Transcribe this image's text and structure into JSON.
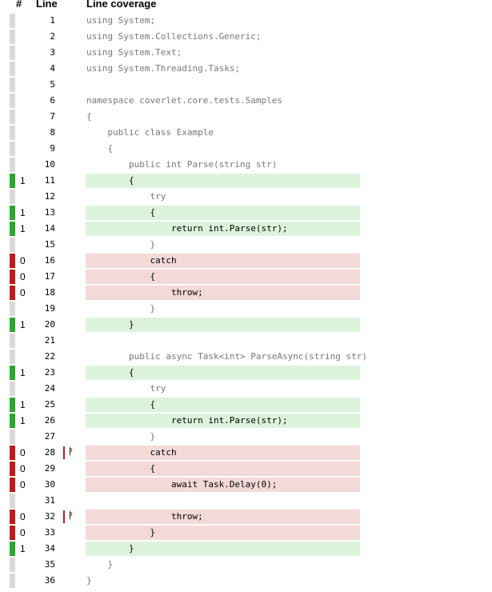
{
  "header": {
    "hash": "#",
    "line": "Line",
    "coverage": "Line coverage"
  },
  "colors": {
    "covered": "#2aa82a",
    "uncovered": "#c21a1a",
    "covered_bg": "#dcf4dc",
    "uncovered_bg": "#f4d9d9",
    "neutral": "#d9d9d9"
  },
  "lines": [
    {
      "n": "1",
      "hits": "",
      "status": "none",
      "branch": false,
      "code": "using System;"
    },
    {
      "n": "2",
      "hits": "",
      "status": "none",
      "branch": false,
      "code": "using System.Collections.Generic;"
    },
    {
      "n": "3",
      "hits": "",
      "status": "none",
      "branch": false,
      "code": "using System.Text;"
    },
    {
      "n": "4",
      "hits": "",
      "status": "none",
      "branch": false,
      "code": "using System.Threading.Tasks;"
    },
    {
      "n": "5",
      "hits": "",
      "status": "none",
      "branch": false,
      "code": ""
    },
    {
      "n": "6",
      "hits": "",
      "status": "none",
      "branch": false,
      "code": "namespace coverlet.core.tests.Samples"
    },
    {
      "n": "7",
      "hits": "",
      "status": "none",
      "branch": false,
      "code": "{"
    },
    {
      "n": "8",
      "hits": "",
      "status": "none",
      "branch": false,
      "code": "    public class Example"
    },
    {
      "n": "9",
      "hits": "",
      "status": "none",
      "branch": false,
      "code": "    {"
    },
    {
      "n": "10",
      "hits": "",
      "status": "none",
      "branch": false,
      "code": "        public int Parse(string str)"
    },
    {
      "n": "11",
      "hits": "1",
      "status": "covered",
      "branch": false,
      "code": "        {"
    },
    {
      "n": "12",
      "hits": "",
      "status": "none",
      "branch": false,
      "code": "            try"
    },
    {
      "n": "13",
      "hits": "1",
      "status": "covered",
      "branch": false,
      "code": "            {"
    },
    {
      "n": "14",
      "hits": "1",
      "status": "covered",
      "branch": false,
      "code": "                return int.Parse(str);"
    },
    {
      "n": "15",
      "hits": "",
      "status": "none",
      "branch": false,
      "code": "            }"
    },
    {
      "n": "16",
      "hits": "0",
      "status": "uncovered",
      "branch": false,
      "code": "            catch"
    },
    {
      "n": "17",
      "hits": "0",
      "status": "uncovered",
      "branch": false,
      "code": "            {"
    },
    {
      "n": "18",
      "hits": "0",
      "status": "uncovered",
      "branch": false,
      "code": "                throw;"
    },
    {
      "n": "19",
      "hits": "",
      "status": "none",
      "branch": false,
      "code": "            }"
    },
    {
      "n": "20",
      "hits": "1",
      "status": "covered",
      "branch": false,
      "code": "        }"
    },
    {
      "n": "21",
      "hits": "",
      "status": "none",
      "branch": false,
      "code": ""
    },
    {
      "n": "22",
      "hits": "",
      "status": "none",
      "branch": false,
      "code": "        public async Task<int> ParseAsync(string str)"
    },
    {
      "n": "23",
      "hits": "1",
      "status": "covered",
      "branch": false,
      "code": "        {"
    },
    {
      "n": "24",
      "hits": "",
      "status": "none",
      "branch": false,
      "code": "            try"
    },
    {
      "n": "25",
      "hits": "1",
      "status": "covered",
      "branch": false,
      "code": "            {"
    },
    {
      "n": "26",
      "hits": "1",
      "status": "covered",
      "branch": false,
      "code": "                return int.Parse(str);"
    },
    {
      "n": "27",
      "hits": "",
      "status": "none",
      "branch": false,
      "code": "            }"
    },
    {
      "n": "28",
      "hits": "0",
      "status": "uncovered",
      "branch": true,
      "code": "            catch"
    },
    {
      "n": "29",
      "hits": "0",
      "status": "uncovered",
      "branch": false,
      "code": "            {"
    },
    {
      "n": "30",
      "hits": "0",
      "status": "uncovered",
      "branch": false,
      "code": "                await Task.Delay(0);"
    },
    {
      "n": "31",
      "hits": "",
      "status": "none",
      "branch": false,
      "code": ""
    },
    {
      "n": "32",
      "hits": "0",
      "status": "uncovered",
      "branch": true,
      "code": "                throw;"
    },
    {
      "n": "33",
      "hits": "0",
      "status": "uncovered",
      "branch": false,
      "code": "            }"
    },
    {
      "n": "34",
      "hits": "1",
      "status": "covered",
      "branch": false,
      "code": "        }"
    },
    {
      "n": "35",
      "hits": "",
      "status": "none",
      "branch": false,
      "code": "    }"
    },
    {
      "n": "36",
      "hits": "",
      "status": "none",
      "branch": false,
      "code": "}"
    }
  ]
}
